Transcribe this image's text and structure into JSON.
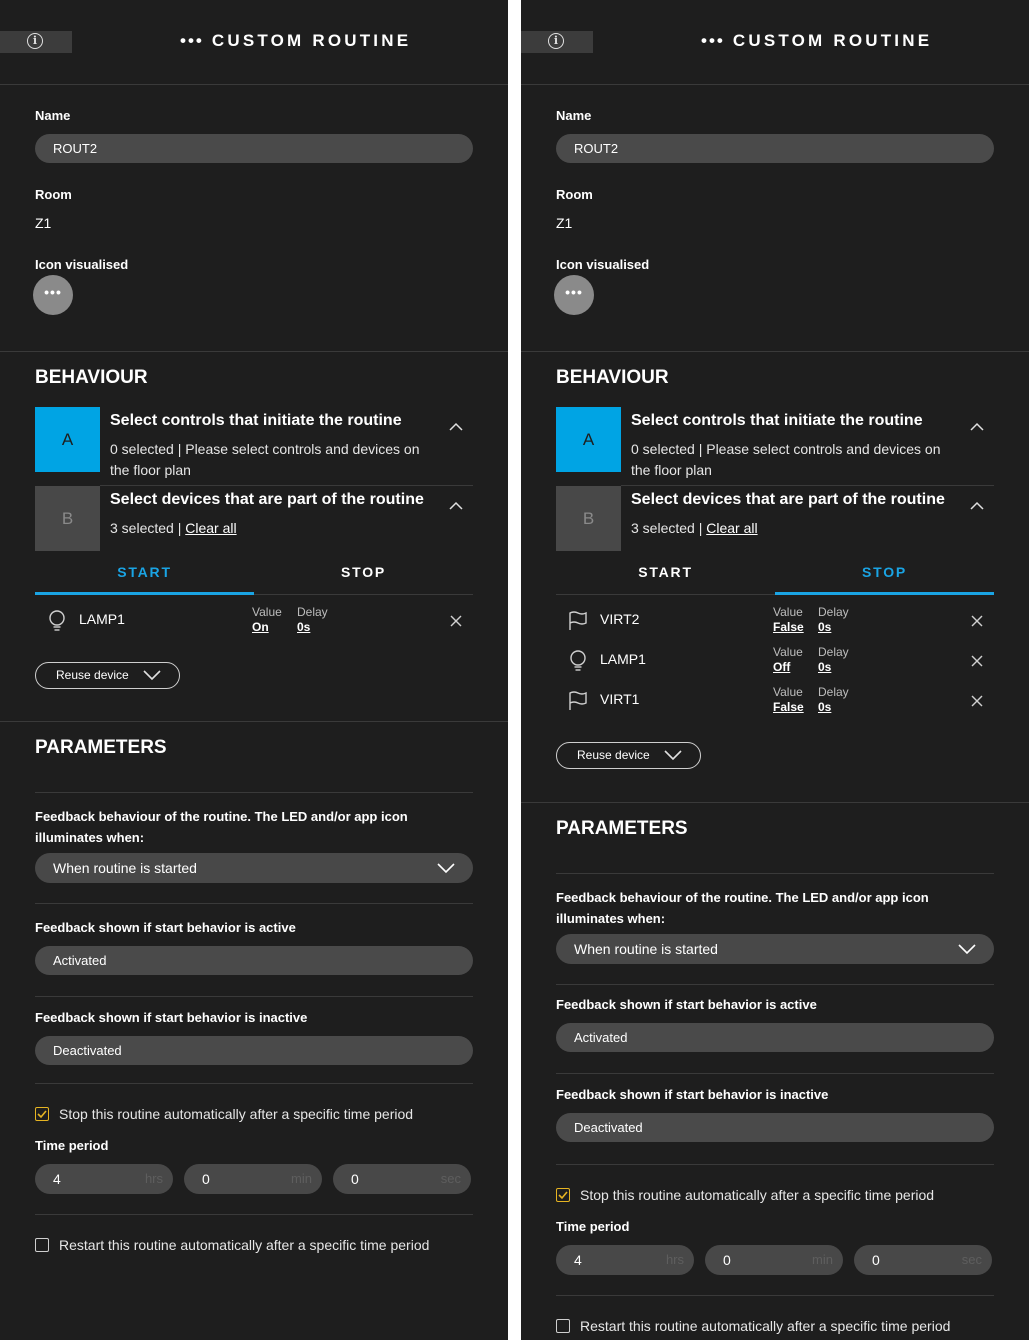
{
  "header": {
    "title": "CUSTOM ROUTINE",
    "dots": "•••",
    "info_icon": "info-icon"
  },
  "general": {
    "name_label": "Name",
    "name_value": "ROUT2",
    "room_label": "Room",
    "room_value": "Z1",
    "icon_label": "Icon visualised",
    "icon_glyph": "•••"
  },
  "behaviour": {
    "title": "BEHAVIOUR",
    "a": {
      "letter": "A",
      "title": "Select controls that initiate the routine",
      "subtitle_line1": "0 selected | Please select controls and devices on",
      "subtitle_line2": "the floor plan"
    },
    "b": {
      "letter": "B",
      "title": "Select devices that are part of the routine",
      "count": "3 selected | ",
      "clear": "Clear all"
    },
    "tabs": {
      "start": "START",
      "stop": "STOP"
    },
    "value_label": "Value",
    "delay_label": "Delay",
    "reuse_label": "Reuse device",
    "start_devices": [
      {
        "icon": "lightbulb-icon",
        "name": "LAMP1",
        "value": "On",
        "delay": "0s"
      }
    ],
    "stop_devices": [
      {
        "icon": "flag-icon",
        "name": "VIRT2",
        "value": "False",
        "delay": "0s"
      },
      {
        "icon": "lightbulb-icon",
        "name": "LAMP1",
        "value": "Off",
        "delay": "0s"
      },
      {
        "icon": "flag-icon",
        "name": "VIRT1",
        "value": "False",
        "delay": "0s"
      }
    ]
  },
  "parameters": {
    "title": "PARAMETERS",
    "feedback_label_line1": "Feedback behaviour of the routine. The LED and/or app icon",
    "feedback_label_line2": "illuminates when:",
    "feedback_value": "When routine is started",
    "active_label": "Feedback shown if start behavior is active",
    "active_value": "Activated",
    "inactive_label": "Feedback shown if start behavior is inactive",
    "inactive_value": "Deactivated",
    "stop_auto_label": "Stop this routine automatically after a specific time period",
    "stop_auto_checked": true,
    "time_period_label": "Time period",
    "hours": "4",
    "hours_unit": "hrs",
    "minutes": "0",
    "minutes_unit": "min",
    "seconds": "0",
    "seconds_unit": "sec",
    "restart_label": "Restart this routine automatically after a specific time period",
    "restart_checked": false
  },
  "colors": {
    "accent": "#00a4e4",
    "tab_active": "#1aa4e4",
    "panel_bg": "#1e1e1e",
    "check": "#e6b422"
  }
}
